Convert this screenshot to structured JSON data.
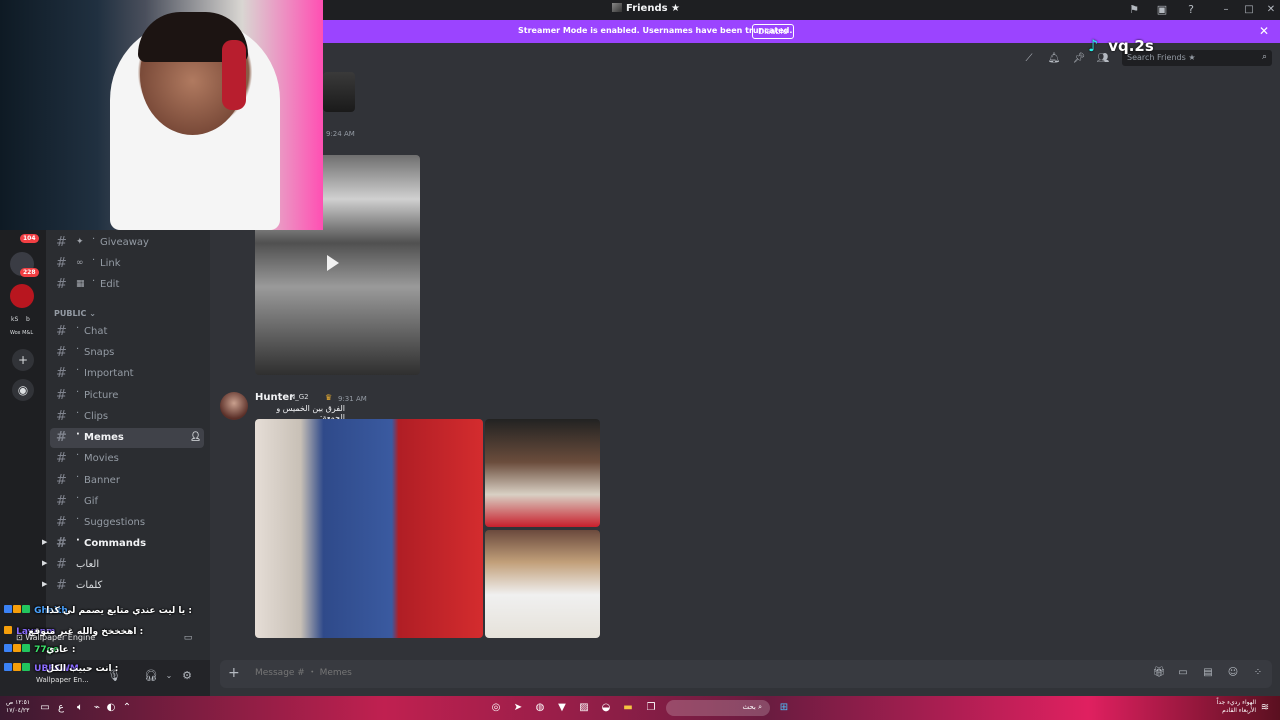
{
  "window": {
    "title": "Friends",
    "title_icon": "star-icon"
  },
  "banner": {
    "text": "Streamer Mode is enabled. Usernames have been truncated.",
    "button": "Disable",
    "color": "#9b44ff"
  },
  "overlay": {
    "tiktok_handle": "vq.2s",
    "chat": [
      {
        "name": "Ghaith",
        "text": "يا ليت عندي متابع يصمم لي كذا :"
      },
      {
        "name": "Layanm",
        "text": "اهخخخخ والله غير متوقع :"
      },
      {
        "name": "77ge",
        "text": "عادي :"
      },
      {
        "name": "UBFAWM",
        "text": "انت حبيب الكل :"
      }
    ],
    "wallpaper": "Wallpaper Engine",
    "wallpaper_short": "Wallpaper En..."
  },
  "servers": {
    "badges": [
      "104",
      "228"
    ],
    "labels": [
      "kS",
      "b",
      "Wox M&L"
    ]
  },
  "channels": {
    "top": [
      {
        "label": "Giveaway",
        "icon": "party-icon"
      },
      {
        "label": "Link",
        "icon": "link-icon"
      },
      {
        "label": "Edit",
        "icon": "film-icon"
      }
    ],
    "category": "PUBLIC",
    "items": [
      "Chat",
      "Snaps",
      "Important",
      "Picture",
      "Clips",
      "Memes",
      "Movies",
      "Banner",
      "Gif",
      "Suggestions",
      "Commands",
      "العاب",
      "كلمات"
    ],
    "active": "Memes"
  },
  "header": {
    "search_placeholder": "Search Friends"
  },
  "messages": [
    {
      "time": "9:24 AM"
    },
    {
      "author": "Hunter",
      "tag": "N_G2",
      "time": "9:31 AM",
      "text": "الفرق بين الخميس و الجمعة:"
    }
  ],
  "composer": {
    "placeholder": "Message # ・ Memes"
  },
  "taskbar": {
    "time": "١٢:٥١ ص",
    "date": "١٧/٠٤/٢٣",
    "weather": "الهواء رديء جداً",
    "weather_sub": "الأربعاء القادم",
    "search_text": "بحث"
  }
}
